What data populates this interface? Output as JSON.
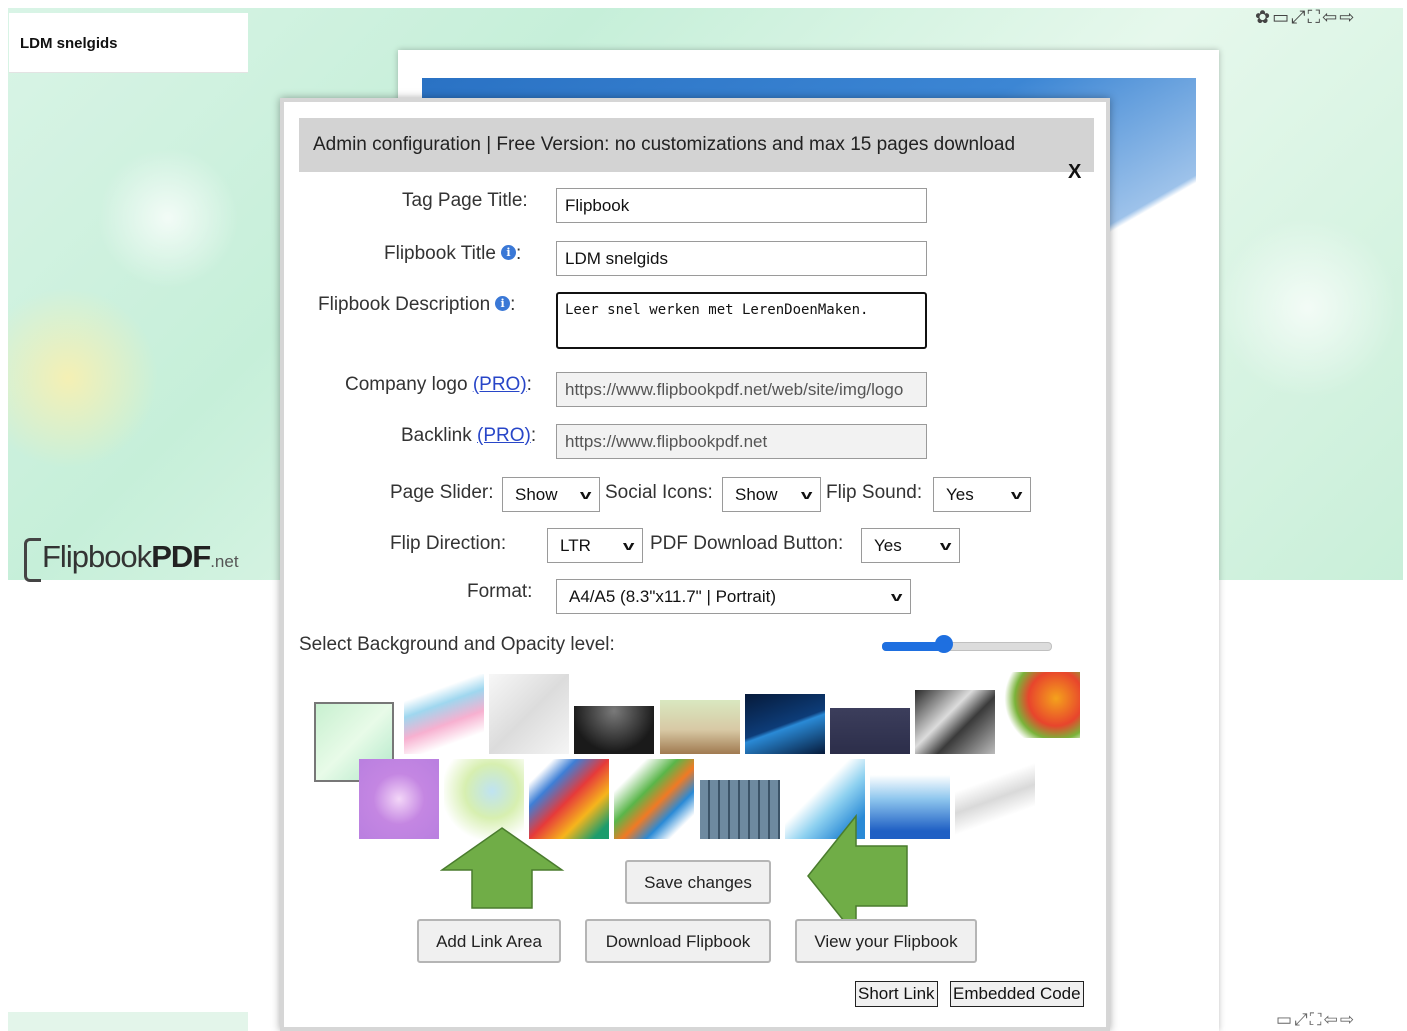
{
  "sidebar": {
    "toc_title": "LDM snelgids"
  },
  "brand": {
    "logo_main": "Flipbook",
    "logo_bold": "PDF",
    "logo_suffix": ".net"
  },
  "viewer_toolbar": {
    "top_icons": [
      "gear-icon",
      "pdf-icon",
      "expand-icon",
      "fullscreen-icon",
      "arrow-left-icon",
      "arrow-right-icon"
    ],
    "bottom_icons": [
      "pdf-icon",
      "expand-icon",
      "fullscreen-icon",
      "arrow-left-icon",
      "arrow-right-icon"
    ],
    "top_glyphs": [
      "✿",
      "▭",
      "⤢",
      "⛶",
      "⇦",
      "⇨"
    ],
    "bottom_glyphs": [
      "▭",
      "⤢",
      "⛶",
      "⇦",
      "⇨"
    ]
  },
  "modal": {
    "header": "Admin configuration | Free Version: no customizations and max 15 pages download",
    "close": "X",
    "fields": {
      "tag_page_title": {
        "label": "Tag Page Title:",
        "value": "Flipbook"
      },
      "flipbook_title": {
        "label": "Flipbook Title",
        "value": "LDM snelgids"
      },
      "flipbook_description": {
        "label": "Flipbook Description",
        "value": "Leer snel werken met LerenDoenMaken."
      },
      "company_logo": {
        "label": "Company logo",
        "pro": "(PRO)",
        "value": "https://www.flipbookpdf.net/web/site/img/logo"
      },
      "backlink": {
        "label": "Backlink",
        "pro": "(PRO)",
        "value": "https://www.flipbookpdf.net"
      }
    },
    "selects": {
      "page_slider": {
        "label": "Page Slider:",
        "value": "Show"
      },
      "social_icons": {
        "label": "Social Icons:",
        "value": "Show"
      },
      "flip_sound": {
        "label": "Flip Sound:",
        "value": "Yes"
      },
      "flip_direction": {
        "label": "Flip Direction:",
        "value": "LTR"
      },
      "pdf_download_button": {
        "label": "PDF Download Button:",
        "value": "Yes"
      },
      "format": {
        "label": "Format:",
        "value": "A4/A5 (8.3\"x11.7\" | Portrait)"
      }
    },
    "background": {
      "label": "Select Background and Opacity level:",
      "opacity": 0.35,
      "selected_index": 0
    },
    "buttons": {
      "save": "Save changes",
      "add_link": "Add Link Area",
      "download": "Download Flipbook",
      "view": "View your Flipbook",
      "short_link": "Short Link",
      "embedded_code": "Embedded Code"
    },
    "colors": {
      "arrow_green": "#70ad47",
      "slider_blue": "#1e6fe0"
    }
  }
}
